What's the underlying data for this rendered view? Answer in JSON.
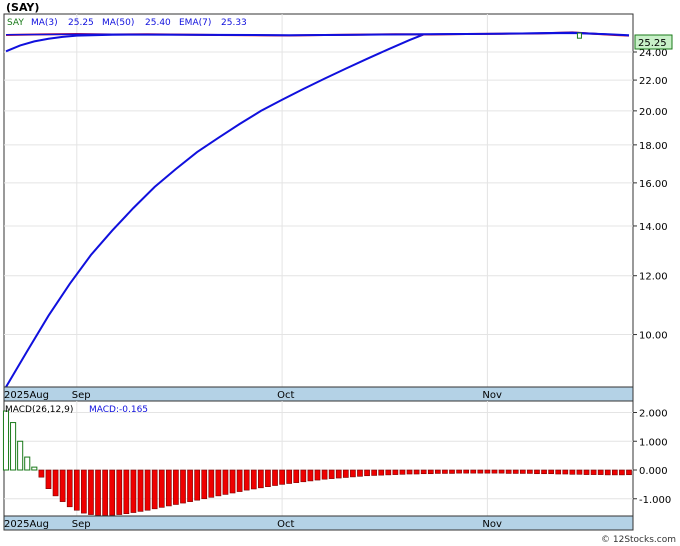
{
  "header": {
    "ticker_title": "(SAY)",
    "symbol": "SAY",
    "ma3_label": "MA(3)",
    "ma3_value": "25.25",
    "ma50_label": "MA(50)",
    "ma50_value": "25.40",
    "ema7_label": "EMA(7)",
    "ema7_value": "25.33",
    "last_price": "25.25"
  },
  "macd": {
    "label": "MACD(26,12,9)",
    "value_label": "MACD:-0.165"
  },
  "watermark": "© 12Stocks.com",
  "colors": {
    "background": "#ffffff",
    "axis_band": "#b4d2e6",
    "ma_line": "#1010dd",
    "price_line": "#ee1111",
    "macd_pos": "#1a7a1a",
    "macd_neg": "#ee0000",
    "last_price_box": "#c8f0c8"
  },
  "chart_data": [
    {
      "type": "line",
      "title": "",
      "scale": "log",
      "y_ticks": [
        "10.00",
        "12.00",
        "14.00",
        "16.00",
        "18.00",
        "20.00",
        "22.00",
        "24.00"
      ],
      "y_tick_values": [
        10,
        12,
        14,
        16,
        18,
        20,
        22,
        24
      ],
      "ylim": [
        8.5,
        27.0
      ],
      "x_tick_labels": [
        "2025Aug",
        "Sep",
        "Oct",
        "Nov"
      ],
      "x_tick_index": [
        0,
        10,
        39,
        68
      ],
      "n_days": 89,
      "last_price": 25.25,
      "series": [
        {
          "name": "MA(50)",
          "x": [
            0,
            3,
            6,
            9,
            12,
            15,
            18,
            21,
            24,
            27,
            30,
            33,
            36,
            39,
            42,
            45,
            48,
            51,
            54,
            57,
            59
          ],
          "values": [
            8.5,
            9.5,
            10.6,
            11.7,
            12.8,
            13.8,
            14.8,
            15.8,
            16.7,
            17.6,
            18.4,
            19.2,
            20.0,
            20.7,
            21.4,
            22.1,
            22.8,
            23.5,
            24.2,
            24.9,
            25.35
          ]
        },
        {
          "name": "Price",
          "x": [
            0,
            5,
            10,
            15,
            20,
            25,
            30,
            35,
            40,
            45,
            50,
            55,
            60,
            65,
            70,
            75,
            80,
            83,
            86,
            88
          ],
          "values": [
            25.3,
            25.35,
            25.38,
            25.34,
            25.36,
            25.33,
            25.3,
            25.28,
            25.26,
            25.3,
            25.33,
            25.36,
            25.34,
            25.38,
            25.4,
            25.42,
            25.5,
            25.4,
            25.3,
            25.25
          ]
        },
        {
          "name": "EMA(7)",
          "x": [
            0,
            2,
            4,
            6,
            8,
            10,
            15,
            20,
            30,
            40,
            50,
            60,
            70,
            80,
            85,
            88
          ],
          "values": [
            24.05,
            24.5,
            24.8,
            25.0,
            25.15,
            25.25,
            25.32,
            25.33,
            25.31,
            25.28,
            25.32,
            25.36,
            25.4,
            25.46,
            25.36,
            25.28
          ]
        },
        {
          "name": "MA(3)",
          "x": [
            0,
            10,
            20,
            30,
            40,
            50,
            60,
            70,
            80,
            85,
            88
          ],
          "values": [
            25.32,
            25.36,
            25.34,
            25.3,
            25.27,
            25.32,
            25.37,
            25.41,
            25.5,
            25.36,
            25.25
          ]
        }
      ],
      "candles": [
        {
          "x": 81,
          "open": 25.45,
          "close": 25.05
        }
      ]
    },
    {
      "type": "bar",
      "title": "",
      "ylim": [
        -1.6,
        2.4
      ],
      "y_ticks": [
        "2.000",
        "1.000",
        "0.000",
        "-1.000"
      ],
      "y_tick_values": [
        2.0,
        1.0,
        0.0,
        -1.0
      ],
      "x_tick_labels": [
        "2025Aug",
        "Sep",
        "Oct",
        "Nov"
      ],
      "x_tick_index": [
        0,
        10,
        39,
        68
      ],
      "bar_x": [
        0,
        1,
        2,
        3,
        4,
        5,
        6,
        7,
        8,
        9,
        10,
        11,
        12,
        13,
        14,
        15,
        16,
        17,
        18,
        19,
        20,
        21,
        22,
        23,
        24,
        25,
        26,
        27,
        28,
        29,
        30,
        31,
        32,
        33,
        34,
        35,
        36,
        37,
        38,
        39,
        40,
        41,
        42,
        43,
        44,
        45,
        46,
        47,
        48,
        49,
        50,
        51,
        52,
        53,
        54,
        55,
        56,
        57,
        58,
        59,
        60,
        61,
        62,
        63,
        64,
        65,
        66,
        67,
        68,
        69,
        70,
        71,
        72,
        73,
        74,
        75,
        76,
        77,
        78,
        79,
        80,
        81,
        82,
        83,
        84,
        85,
        86,
        87,
        88
      ],
      "values": [
        2.05,
        1.65,
        1.0,
        0.45,
        0.1,
        -0.25,
        -0.65,
        -0.9,
        -1.1,
        -1.28,
        -1.4,
        -1.5,
        -1.55,
        -1.58,
        -1.58,
        -1.57,
        -1.55,
        -1.52,
        -1.48,
        -1.44,
        -1.4,
        -1.35,
        -1.3,
        -1.25,
        -1.2,
        -1.15,
        -1.1,
        -1.05,
        -1.0,
        -0.95,
        -0.9,
        -0.85,
        -0.8,
        -0.75,
        -0.7,
        -0.66,
        -0.62,
        -0.58,
        -0.54,
        -0.5,
        -0.47,
        -0.44,
        -0.41,
        -0.38,
        -0.35,
        -0.32,
        -0.3,
        -0.28,
        -0.26,
        -0.24,
        -0.22,
        -0.2,
        -0.19,
        -0.18,
        -0.17,
        -0.16,
        -0.15,
        -0.14,
        -0.14,
        -0.13,
        -0.13,
        -0.12,
        -0.12,
        -0.12,
        -0.11,
        -0.11,
        -0.11,
        -0.11,
        -0.11,
        -0.11,
        -0.11,
        -0.12,
        -0.12,
        -0.12,
        -0.12,
        -0.13,
        -0.13,
        -0.13,
        -0.14,
        -0.14,
        -0.15,
        -0.15,
        -0.16,
        -0.16,
        -0.16,
        -0.17,
        -0.17,
        -0.17,
        -0.165
      ]
    }
  ]
}
